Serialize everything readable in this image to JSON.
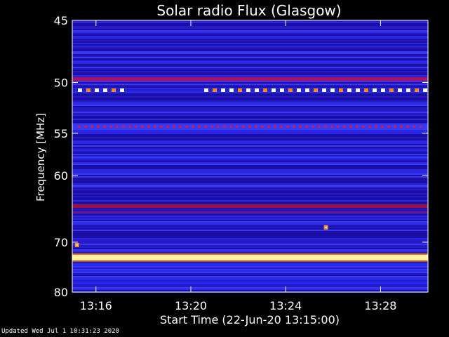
{
  "chart_data": {
    "type": "heatmap",
    "title": "Solar radio Flux (Glasgow)",
    "xlabel": "Start Time (22-Jun-20 13:15:00)",
    "ylabel": "Frequency [MHz]",
    "x_range_minutes": [
      13.17,
      13.5
    ],
    "x_ticks": [
      {
        "label": "13:16",
        "value": 16
      },
      {
        "label": "13:20",
        "value": 20
      },
      {
        "label": "13:24",
        "value": 24
      },
      {
        "label": "13:28",
        "value": 28
      }
    ],
    "y_ticks": [
      {
        "label": "45",
        "value": 45
      },
      {
        "label": "50",
        "value": 50
      },
      {
        "label": "55",
        "value": 55
      },
      {
        "label": "60",
        "value": 60
      },
      {
        "label": "70",
        "value": 70
      },
      {
        "label": "80",
        "value": 80
      }
    ],
    "y_scale": "reciprocal",
    "ylim": [
      45,
      80
    ],
    "xlim_minutes": [
      15.0,
      30.0
    ],
    "background_colors": [
      "#1a0a9a",
      "#2a28e6"
    ],
    "features": [
      {
        "kind": "band",
        "freq_mhz": 49.7,
        "intensity": "medium",
        "color": "#b01060"
      },
      {
        "kind": "dashed-band",
        "freq_mhz": 50.7,
        "intensity": "high",
        "color": "#ffffff",
        "alt_color": "#ff8c00",
        "gap_minutes": [
          17.1,
          20.3
        ]
      },
      {
        "kind": "dashed-band",
        "freq_mhz": 54.3,
        "intensity": "medium",
        "color": "#c0205a"
      },
      {
        "kind": "band",
        "freq_mhz": 64.2,
        "intensity": "medium",
        "color": "#a01040"
      },
      {
        "kind": "band",
        "freq_mhz": 65.1,
        "intensity": "low",
        "color": "#6a1a8a"
      },
      {
        "kind": "band",
        "freq_mhz": 72.8,
        "intensity": "very-high",
        "color": "#fff2a0"
      },
      {
        "kind": "spot",
        "freq_mhz": 67.5,
        "minute": 25.7,
        "intensity": "high",
        "color": "#ff9020"
      },
      {
        "kind": "spot",
        "freq_mhz": 70.5,
        "minute": 15.2,
        "intensity": "high",
        "color": "#ff9020"
      }
    ]
  },
  "footer": {
    "updated": "Updated Wed Jul  1 10:31:23 2020"
  }
}
